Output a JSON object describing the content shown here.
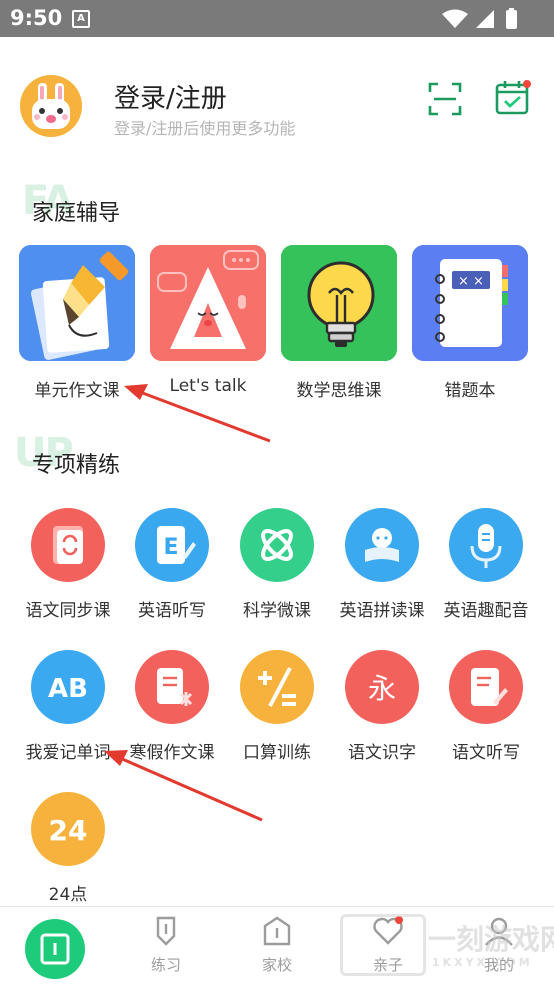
{
  "status_bar": {
    "time": "9:50",
    "notif_letter": "A"
  },
  "header": {
    "title": "登录/注册",
    "subtitle": "登录/注册后使用更多功能"
  },
  "family_section": {
    "title": "家庭辅导",
    "deco": "FA",
    "cards": [
      {
        "label": "单元作文课",
        "icon": "pen-paper-icon",
        "color": "#4e8ff0"
      },
      {
        "label": "Let's talk",
        "icon": "talk-a-icon",
        "color": "#f7706a"
      },
      {
        "label": "数学思维课",
        "icon": "lightbulb-icon",
        "color": "#35c25a"
      },
      {
        "label": "错题本",
        "icon": "notebook-icon",
        "color": "#5b7ef2"
      }
    ]
  },
  "special_section": {
    "title": "专项精练",
    "deco": "UP",
    "items": [
      {
        "label": "语文同步课",
        "icon": "book-sync-icon",
        "color": "#f2615c"
      },
      {
        "label": "英语听写",
        "icon": "letter-e-icon",
        "color": "#39a8ef"
      },
      {
        "label": "科学微课",
        "icon": "atom-icon",
        "color": "#35cf8c"
      },
      {
        "label": "英语拼读课",
        "icon": "reader-icon",
        "color": "#3aa9f0"
      },
      {
        "label": "英语趣配音",
        "icon": "microphone-icon",
        "color": "#3aa9f0"
      },
      {
        "label": "我爱记单词",
        "icon": "ab-icon",
        "color": "#3aa9f0",
        "text": "AB"
      },
      {
        "label": "寒假作文课",
        "icon": "writing-icon",
        "color": "#f2615c"
      },
      {
        "label": "口算训练",
        "icon": "math-signs-icon",
        "color": "#f6b23c"
      },
      {
        "label": "语文识字",
        "icon": "character-yong-icon",
        "color": "#f2615c",
        "text": "永"
      },
      {
        "label": "语文听写",
        "icon": "dictation-icon",
        "color": "#f2615c"
      },
      {
        "label": "24点",
        "icon": "number-24-icon",
        "color": "#f6b23c",
        "text": "24"
      }
    ]
  },
  "bottom_nav": {
    "items": [
      {
        "label": "",
        "icon": "home-book-icon"
      },
      {
        "label": "练习",
        "icon": "practice-icon"
      },
      {
        "label": "家校",
        "icon": "school-icon"
      },
      {
        "label": "亲子",
        "icon": "heart-icon"
      },
      {
        "label": "我的",
        "icon": "profile-icon"
      }
    ]
  },
  "watermark": {
    "text": "一刻游戏网",
    "sub": "1KXYX.COM"
  },
  "colors": {
    "accent": "#1ecb7b",
    "arrow": "#e33a2f"
  }
}
